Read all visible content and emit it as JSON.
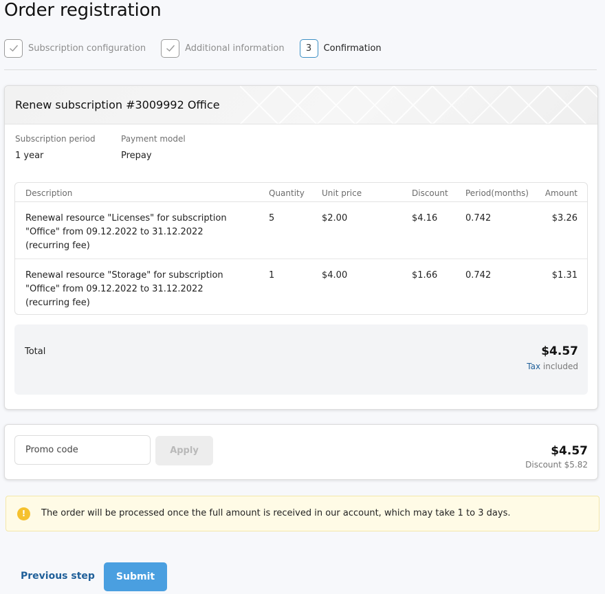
{
  "page": {
    "title": "Order registration"
  },
  "steps": [
    {
      "label": "Subscription configuration",
      "state": "done",
      "icon": "check-icon"
    },
    {
      "label": "Additional information",
      "state": "done",
      "icon": "check-icon"
    },
    {
      "number": "3",
      "label": "Confirmation",
      "state": "active"
    }
  ],
  "order": {
    "title": "Renew subscription #3009992 Office",
    "period_label": "Subscription period",
    "period_value": "1 year",
    "payment_label": "Payment model",
    "payment_value": "Prepay",
    "table": {
      "headers": [
        "Description",
        "Quantity",
        "Unit price",
        "Discount",
        "Period(months)",
        "Amount"
      ],
      "rows": [
        {
          "description_lines": [
            "Renewal resource \"Licenses\" for subscription",
            "\"Office\" from 09.12.2022 to 31.12.2022",
            "(recurring fee)"
          ],
          "quantity": "5",
          "unit_price": "$2.00",
          "discount": "$4.16",
          "period": "0.742",
          "amount": "$3.26"
        },
        {
          "description_lines": [
            "Renewal resource \"Storage\" for subscription",
            "\"Office\" from 09.12.2022 to 31.12.2022",
            "(recurring fee)"
          ],
          "quantity": "1",
          "unit_price": "$4.00",
          "discount": "$1.66",
          "period": "0.742",
          "amount": "$1.31"
        }
      ]
    },
    "total_label": "Total",
    "total_amount": "$4.57",
    "tax_link": "Tax",
    "tax_suffix": " included"
  },
  "promo": {
    "placeholder": "Promo code",
    "apply_label": "Apply",
    "amount": "$4.57",
    "discount_text": "Discount $5.82"
  },
  "notice": {
    "icon": "info-icon",
    "text": "The order will be processed once the full amount is received in our account, which may take 1 to 3 days."
  },
  "actions": {
    "previous_label": "Previous step",
    "submit_label": "Submit"
  },
  "colors": {
    "accent": "#4a9fe0",
    "link": "#1f5f99",
    "notice_bg": "#fffbe6",
    "notice_icon": "#f5c12e"
  }
}
